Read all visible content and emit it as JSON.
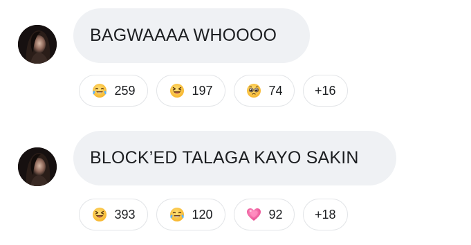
{
  "messages": [
    {
      "text": "BAGWAAAA WHOOOO",
      "reactions": [
        {
          "icon": "tears-of-joy-emoji",
          "count": "259"
        },
        {
          "icon": "laughing-squint-emoji",
          "count": "197"
        },
        {
          "icon": "pleading-face-emoji",
          "count": "74"
        },
        {
          "more": "+16"
        }
      ]
    },
    {
      "text": "BLOCK’ED TALAGA KAYO SAKIN",
      "reactions": [
        {
          "icon": "laughing-squint-emoji",
          "count": "393"
        },
        {
          "icon": "tears-of-joy-emoji",
          "count": "120"
        },
        {
          "icon": "growing-heart-emoji",
          "count": "92"
        },
        {
          "more": "+18"
        }
      ]
    }
  ],
  "colors": {
    "bubble_bg": "#eff1f4",
    "text": "#1c1e21",
    "chip_border": "#e3e5e8",
    "emoji_yellow": "#ffcc3a",
    "heart_pink": "#f06ba8"
  }
}
